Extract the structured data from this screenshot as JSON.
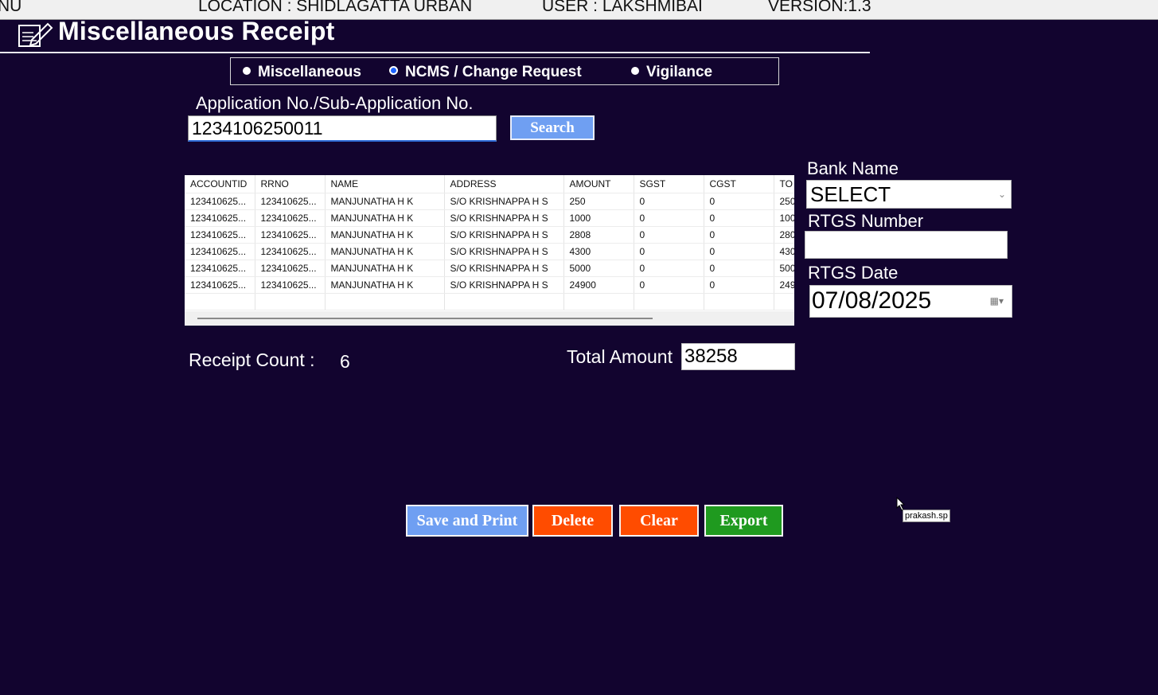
{
  "topbar": {
    "menu_fragment": "NU",
    "location": "LOCATION : SHIDLAGATTA URBAN",
    "user": "USER :   LAKSHMIBAI",
    "version": "VERSION:1.3"
  },
  "page": {
    "title": "Miscellaneous Receipt",
    "title_icon": "edit-document-icon"
  },
  "receipt_type": {
    "options": [
      "Miscellaneous",
      "NCMS / Change Request",
      "Vigilance"
    ],
    "selected": "NCMS / Change Request"
  },
  "application": {
    "label": "Application No./Sub-Application No.",
    "value": "1234106250011",
    "search_label": "Search"
  },
  "grid": {
    "columns": [
      "ACCOUNTID",
      "RRNO",
      "NAME",
      "ADDRESS",
      "AMOUNT",
      "SGST",
      "CGST",
      "TO"
    ],
    "rows": [
      [
        "123410625...",
        "123410625...",
        "MANJUNATHA H K",
        "S/O KRISHNAPPA H S",
        "250",
        "0",
        "0",
        "250"
      ],
      [
        "123410625...",
        "123410625...",
        "MANJUNATHA H K",
        "S/O KRISHNAPPA H S",
        "1000",
        "0",
        "0",
        "100"
      ],
      [
        "123410625...",
        "123410625...",
        "MANJUNATHA H K",
        "S/O KRISHNAPPA H S",
        "2808",
        "0",
        "0",
        "280"
      ],
      [
        "123410625...",
        "123410625...",
        "MANJUNATHA H K",
        "S/O KRISHNAPPA H S",
        "4300",
        "0",
        "0",
        "430"
      ],
      [
        "123410625...",
        "123410625...",
        "MANJUNATHA H K",
        "S/O KRISHNAPPA H S",
        "5000",
        "0",
        "0",
        "500"
      ],
      [
        "123410625...",
        "123410625...",
        "MANJUNATHA H K",
        "S/O KRISHNAPPA H S",
        "24900",
        "0",
        "0",
        "249"
      ]
    ]
  },
  "bank": {
    "bank_name_label": "Bank Name",
    "bank_name_value": "SELECT",
    "rtgs_number_label": "RTGS Number",
    "rtgs_number_value": "",
    "rtgs_date_label": "RTGS Date",
    "rtgs_date_value": "07/08/2025"
  },
  "summary": {
    "receipt_count_label": "Receipt Count :",
    "receipt_count_value": "6",
    "total_amount_label": "Total Amount",
    "total_amount_value": "38258"
  },
  "actions": {
    "save_print": "Save and Print",
    "delete": "Delete",
    "clear": "Clear",
    "export": "Export"
  },
  "tooltip": "prakash.sp",
  "colors": {
    "background": "#12042f",
    "primary_button": "#6f9ff2",
    "danger_button": "#ff4c00",
    "export_button": "#1f9a1f",
    "radio_selected": "#1e63ff"
  }
}
